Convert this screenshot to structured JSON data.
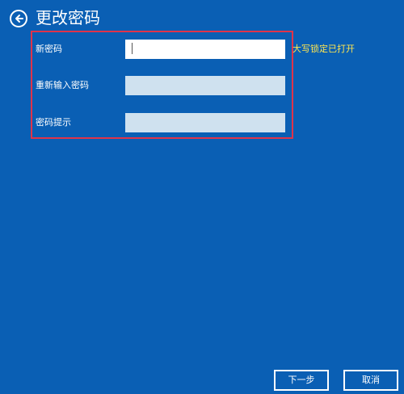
{
  "header": {
    "title": "更改密码",
    "back_icon": "back-arrow-circle-icon"
  },
  "form": {
    "fields": [
      {
        "label": "新密码",
        "value": "",
        "state": "active"
      },
      {
        "label": "重新输入密码",
        "value": "",
        "state": "disabled"
      },
      {
        "label": "密码提示",
        "value": "",
        "state": "disabled"
      }
    ],
    "capslock_notice": "大写锁定已打开"
  },
  "footer": {
    "next_label": "下一步",
    "cancel_label": "取消"
  },
  "colors": {
    "background": "#0a5fb4",
    "highlight_border": "#e0344a",
    "notice": "#ffe650",
    "disabled_input": "#cfe1ef"
  }
}
